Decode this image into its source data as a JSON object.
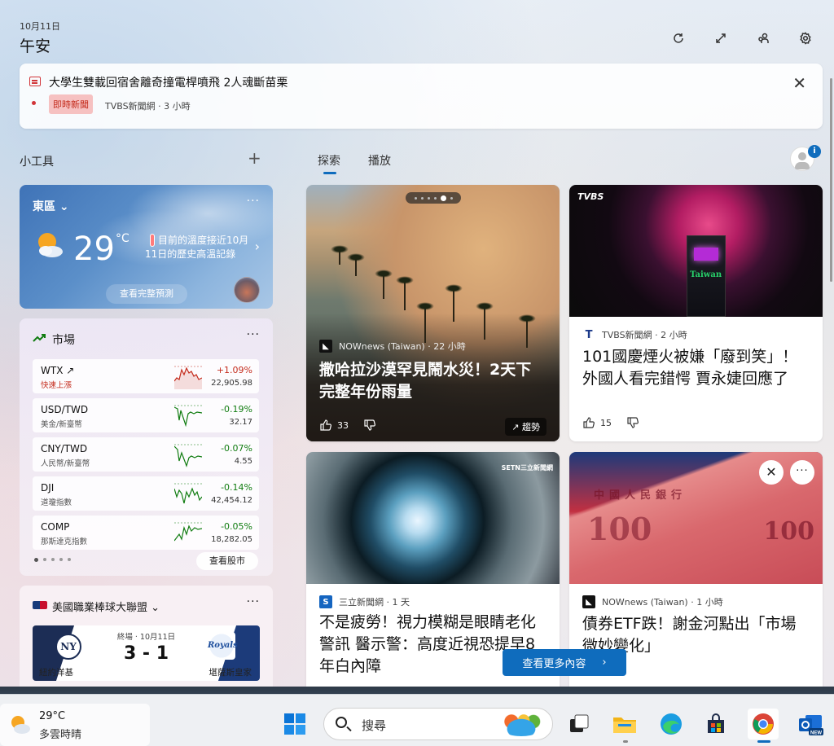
{
  "header": {
    "date": "10月11日",
    "greeting": "午安",
    "icons": [
      "refresh-icon",
      "expand-icon",
      "people-icon",
      "settings-icon"
    ]
  },
  "breaking": {
    "title": "大學生雙載回宿舍離奇撞電桿噴飛 2人魂斷苗栗",
    "badge": "即時新聞",
    "source": "TVBS新聞網 · 3 小時",
    "accent": "#d13438"
  },
  "widgets_section": {
    "title": "小工具",
    "add": "+"
  },
  "tabs": [
    {
      "label": "探索",
      "active": true
    },
    {
      "label": "播放",
      "active": false
    }
  ],
  "profile": {
    "badge": "i"
  },
  "weather": {
    "location": "東區",
    "more": "···",
    "temp": "29",
    "unit": "°C",
    "note": "目前的溫度接近10月11日的歷史高溫記錄",
    "forecast": "查看完整預測"
  },
  "market": {
    "title": "市場",
    "more": "···",
    "rows": [
      {
        "symbol": "WTX",
        "name": "快速上漲",
        "change": "+1.09%",
        "value": "22,905.98",
        "dir": "up"
      },
      {
        "symbol": "USD/TWD",
        "name": "美金/新臺幣",
        "change": "-0.19%",
        "value": "32.17",
        "dir": "down"
      },
      {
        "symbol": "CNY/TWD",
        "name": "人民幣/新臺幣",
        "change": "-0.07%",
        "value": "4.55",
        "dir": "down"
      },
      {
        "symbol": "DJI",
        "name": "道瓊指數",
        "change": "-0.14%",
        "value": "42,454.12",
        "dir": "down"
      },
      {
        "symbol": "COMP",
        "name": "那斯達克指數",
        "change": "-0.05%",
        "value": "18,282.05",
        "dir": "down"
      }
    ],
    "see_more": "查看股市",
    "up_color": "#c42b1c",
    "down_color": "#107c10"
  },
  "mlb": {
    "title": "美國職業棒球大聯盟",
    "more": "···",
    "status": "終場 · 10月11日",
    "score": "3 - 1",
    "team_left": "紐約洋基",
    "team_right": "堪薩斯皇家",
    "left_abbr": "NY",
    "right_abbr": "Royals"
  },
  "cards": [
    {
      "source": "NOWnews (Taiwan) · 22 小時",
      "headline": "撒哈拉沙漠罕見鬧水災！2天下完整年份雨量",
      "likes": "33",
      "trend": "趨勢"
    },
    {
      "source": "TVBS新聞網 · 2 小時",
      "headline": "101國慶煙火被嫌「廢到笑」！外國人看完錯愕 賈永婕回應了",
      "likes": "15",
      "logo_text": "TVBS",
      "tower_text": "Taiwan"
    },
    {
      "source": "三立新聞網 · 1 天",
      "headline": "不是疲勞！視力模糊是眼睛老化警訊 醫示警：高度近視恐提早8年白內障",
      "logo_text": "SETN三立新聞網"
    },
    {
      "source": "NOWnews (Taiwan) · 1 小時",
      "headline": "債券ETF跌！謝金河點出「市場微妙變化」",
      "bill_row": "中國人民銀行",
      "bill_value": "100"
    }
  ],
  "see_more": {
    "label": "查看更多內容",
    "arrow": "›"
  },
  "taskbar": {
    "weather_temp": "29°C",
    "weather_desc": "多雲時晴",
    "search_placeholder": "搜尋"
  }
}
